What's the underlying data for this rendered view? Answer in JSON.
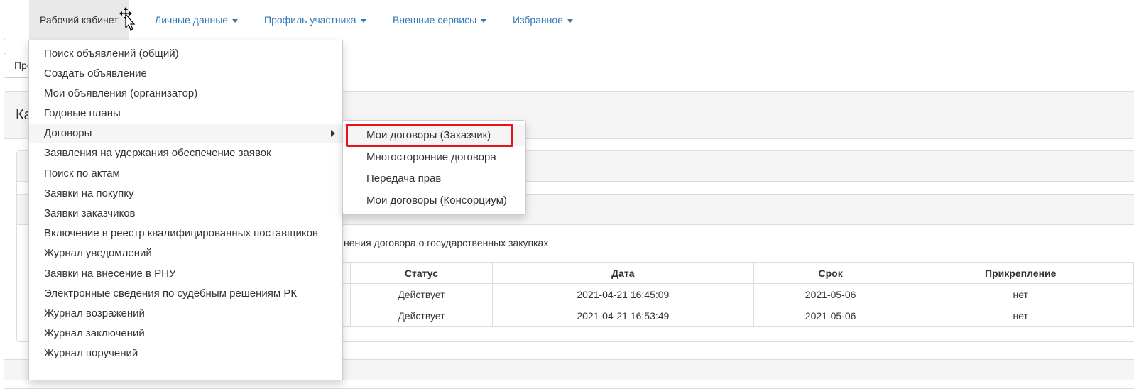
{
  "navbar": {
    "items": [
      {
        "label": "Рабочий кабинет"
      },
      {
        "label": "Личные данные"
      },
      {
        "label": "Профиль участника"
      },
      {
        "label": "Внешние сервисы"
      },
      {
        "label": "Избранное"
      }
    ]
  },
  "background": {
    "button_partial": "Про",
    "panel_title_partial": "Ка",
    "description_partial": "нения договора о государственных закупках"
  },
  "dropdown": {
    "items": [
      {
        "label": "Поиск объявлений (общий)"
      },
      {
        "label": "Создать объявление"
      },
      {
        "label": "Мои объявления (организатор)"
      },
      {
        "label": "Годовые планы"
      },
      {
        "label": "Договоры"
      },
      {
        "label": "Заявления на удержания обеспечение заявок"
      },
      {
        "label": "Поиск по актам"
      },
      {
        "label": "Заявки на покупку"
      },
      {
        "label": "Заявки заказчиков"
      },
      {
        "label": "Включение в реестр квалифицированных поставщиков"
      },
      {
        "label": "Журнал уведомлений"
      },
      {
        "label": "Заявки на внесение в РНУ"
      },
      {
        "label": "Электронные сведения по судебным решениям РК"
      },
      {
        "label": "Журнал возражений"
      },
      {
        "label": "Журнал заключений"
      },
      {
        "label": "Журнал поручений"
      }
    ]
  },
  "submenu": {
    "items": [
      {
        "label": "Мои договоры (Заказчик)"
      },
      {
        "label": "Многосторонние договора"
      },
      {
        "label": "Передача прав"
      },
      {
        "label": "Мои договоры (Консорциум)"
      }
    ]
  },
  "table": {
    "headers": [
      "Статус",
      "Дата",
      "Срок",
      "Прикрепление"
    ],
    "rows": [
      [
        "Действует",
        "2021-04-21 16:45:09",
        "2021-05-06",
        "нет"
      ],
      [
        "Действует",
        "2021-04-21 16:53:49",
        "2021-05-06",
        "нет"
      ]
    ]
  },
  "colors": {
    "link": "#337ab7",
    "highlight": "#e8141a",
    "hover_bg": "#f5f5f5"
  }
}
